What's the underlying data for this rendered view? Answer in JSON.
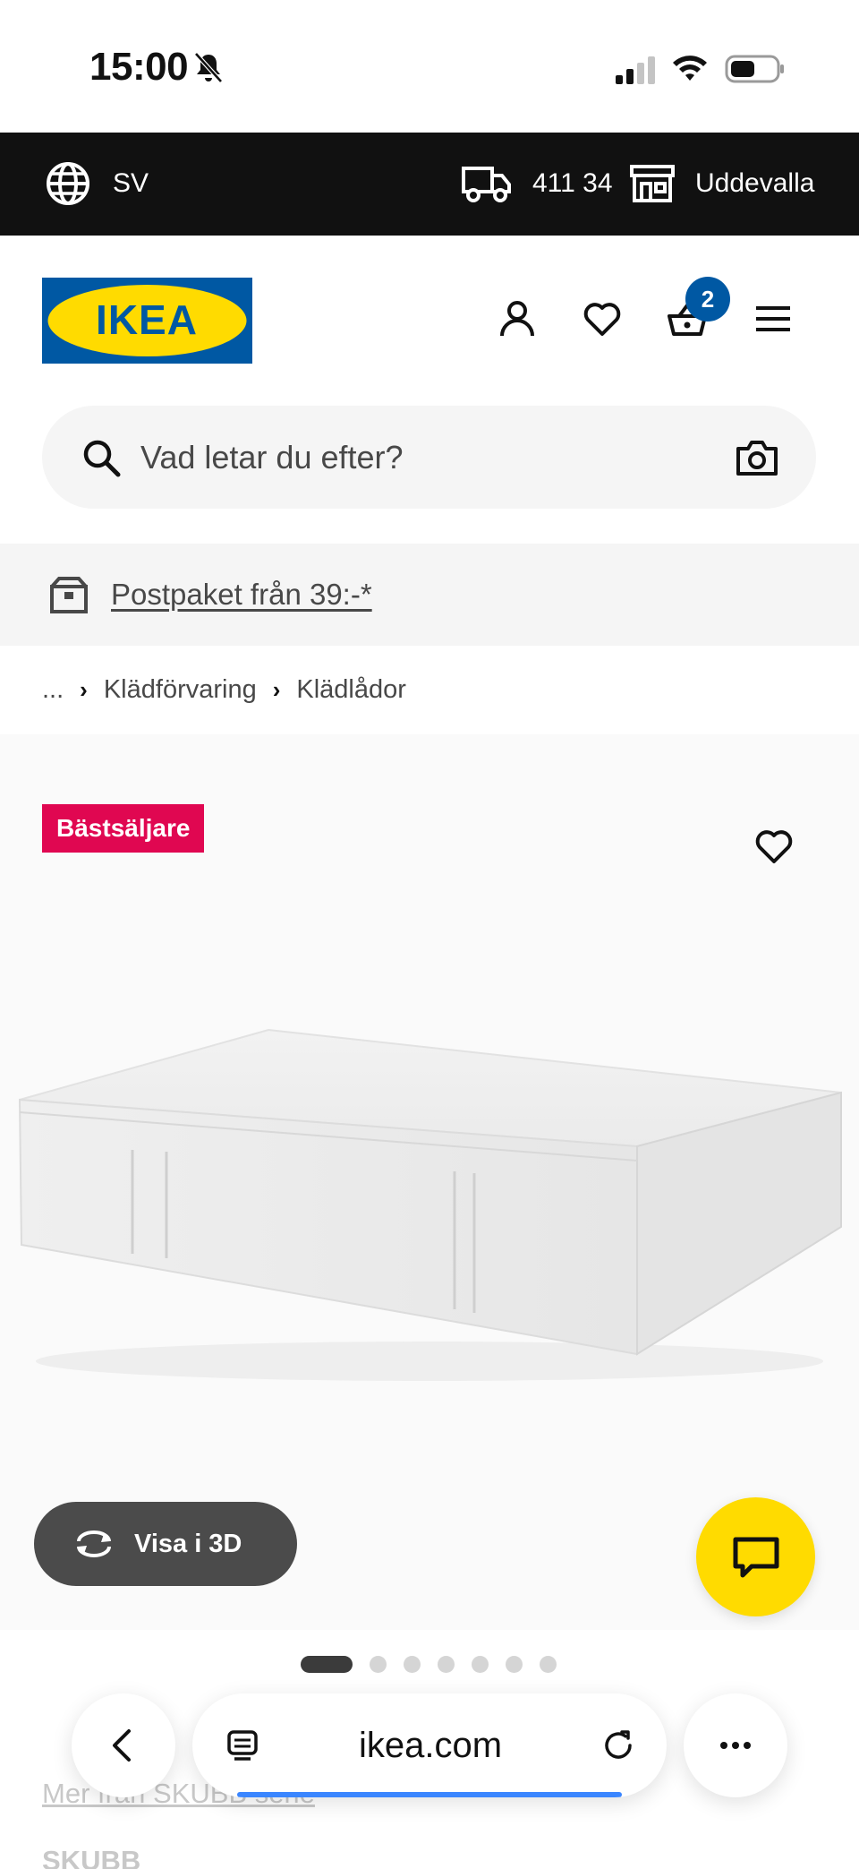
{
  "status": {
    "time": "15:00"
  },
  "top_bar": {
    "language": "SV",
    "postal_code": "411 34",
    "store": "Uddevalla"
  },
  "header": {
    "logo_text": "IKEA",
    "cart_count": "2"
  },
  "search": {
    "placeholder": "Vad letar du efter?"
  },
  "promo": {
    "text": "Postpaket från 39:-*"
  },
  "breadcrumb": {
    "items": [
      "...",
      "Klädförvaring",
      "Klädlådor"
    ]
  },
  "product": {
    "badge": "Bästsäljare",
    "view_3d_label": "Visa i 3D",
    "image_count": 7,
    "active_image_index": 0,
    "series_link": "Mer från SKUBB serie",
    "name": "SKUBB"
  },
  "browser": {
    "url": "ikea.com"
  },
  "colors": {
    "brand_blue": "#0058a3",
    "brand_yellow": "#ffdb00",
    "badge_red": "#e00751",
    "top_bar": "#111111"
  }
}
